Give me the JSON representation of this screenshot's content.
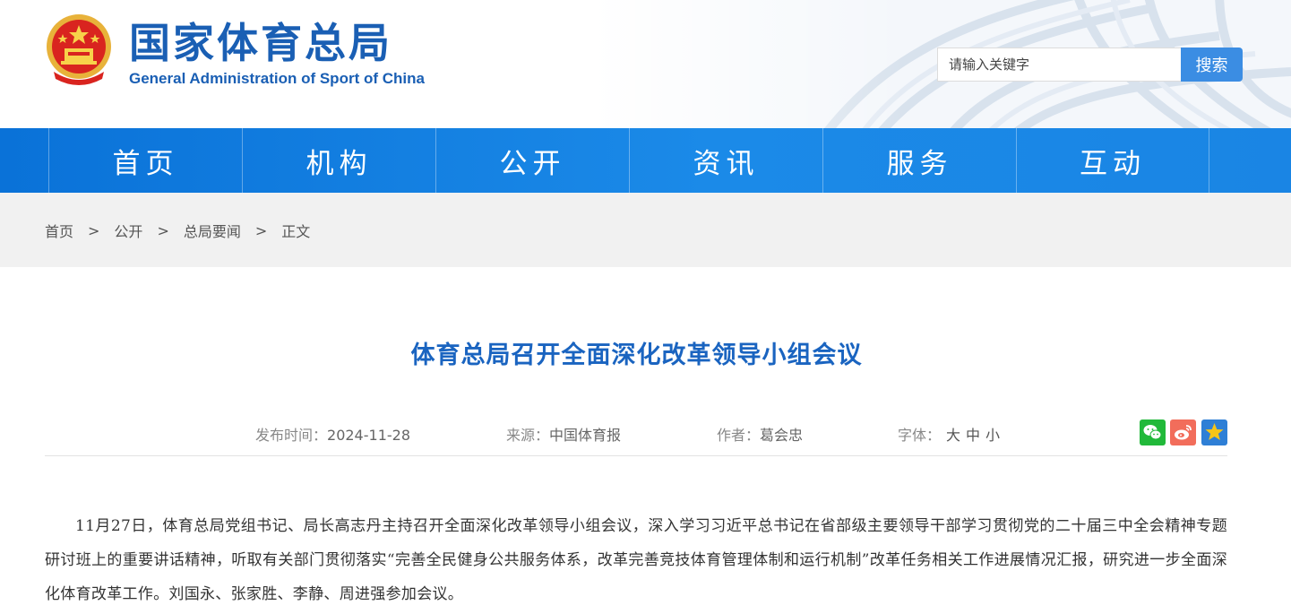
{
  "header": {
    "title": "国家体育总局",
    "subtitle": "General Administration of Sport of China",
    "logo_icon": "national-emblem-icon"
  },
  "search": {
    "placeholder": "请输入关键字",
    "button_label": "搜索"
  },
  "nav": {
    "items": [
      "首页",
      "机构",
      "公开",
      "资讯",
      "服务",
      "互动"
    ]
  },
  "breadcrumb": {
    "items": [
      "首页",
      "公开",
      "总局要闻"
    ],
    "current": "正文",
    "separator": ">"
  },
  "article": {
    "title": "体育总局召开全面深化改革领导小组会议",
    "meta": {
      "publish_label": "发布时间：",
      "publish_date": "2024-11-28",
      "source_label": "来源：",
      "source": "中国体育报",
      "author_label": "作者：",
      "author": "葛会忠",
      "font_label": "字体：",
      "font_sizes": [
        "大",
        "中",
        "小"
      ]
    },
    "share_icons": [
      "wechat-icon",
      "weibo-icon",
      "favorite-star-icon"
    ],
    "body": "11月27日，体育总局党组书记、局长高志丹主持召开全面深化改革领导小组会议，深入学习习近平总书记在省部级主要领导干部学习贯彻党的二十届三中全会精神专题研讨班上的重要讲话精神，听取有关部门贯彻落实“完善全民健身公共服务体系，改革完善竞技体育管理体制和运行机制”改革任务相关工作进展情况汇报，研究进一步全面深化体育改革工作。刘国永、张家胜、李静、周进强参加会议。"
  },
  "colors": {
    "brand_blue": "#1a5fb4",
    "nav_blue": "#0a72d8",
    "title_blue": "#1a64c0",
    "search_button": "#3b8de3",
    "wechat_green": "#21b93a",
    "weibo_red": "#f26d5b",
    "favorite_blue": "#2e7fd6"
  }
}
